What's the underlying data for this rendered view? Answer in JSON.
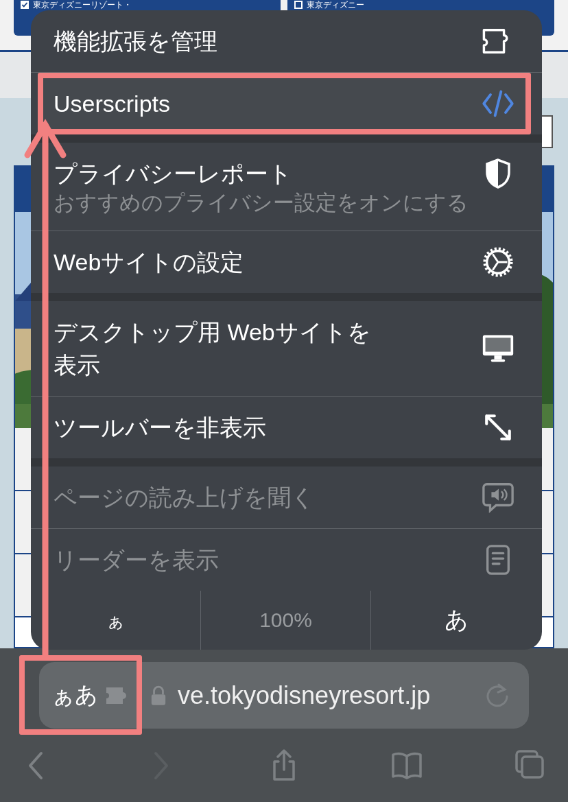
{
  "page": {
    "filters": [
      {
        "label": "東京ディズニーリゾート・",
        "checked": true
      },
      {
        "label": "東京ディズニー",
        "checked": false
      }
    ]
  },
  "menu": {
    "sections": [
      [
        {
          "label": "機能拡張を管理",
          "disabled": false
        },
        {
          "label": "Userscripts",
          "disabled": false,
          "highlighted": true
        }
      ],
      [
        {
          "label": "プライバシーレポート",
          "subtitle": "おすすめのプライバシー設定をオンにする",
          "disabled": false
        },
        {
          "label": "Webサイトの設定",
          "disabled": false
        }
      ],
      [
        {
          "label": "デスクトップ用 Webサイトを表示",
          "disabled": false
        },
        {
          "label": "ツールバーを非表示",
          "disabled": false
        }
      ],
      [
        {
          "label": "ページの読み上げを聞く",
          "disabled": true
        },
        {
          "label": "リーダーを表示",
          "disabled": true
        }
      ]
    ],
    "text_size": {
      "smaller": "ぁ",
      "zoom": "100%",
      "larger": "あ"
    }
  },
  "address_bar": {
    "format_label": "ぁあ",
    "url": "ve.tokyodisneyresort.jp"
  },
  "toolbar": {
    "buttons": [
      {
        "disabled": false
      },
      {
        "disabled": true
      },
      {
        "disabled": false
      },
      {
        "disabled": false
      },
      {
        "disabled": false
      }
    ]
  }
}
